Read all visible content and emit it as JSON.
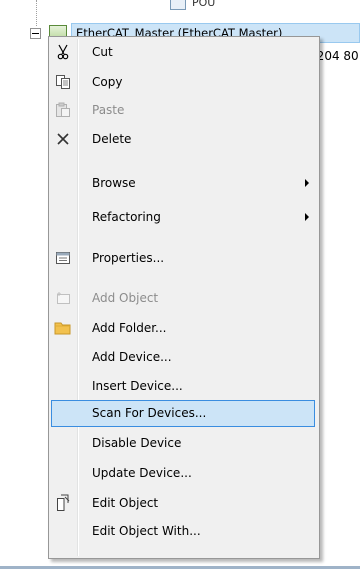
{
  "tree": {
    "top_item_label": "POU",
    "master_label": "EtherCAT_Master (EtherCAT Master)",
    "side_text": "[204 80"
  },
  "menu": {
    "items": [
      {
        "label": "Cut",
        "icon": "scissors-icon",
        "enabled": true
      },
      {
        "label": "Copy",
        "icon": "copy-icon",
        "enabled": true
      },
      {
        "label": "Paste",
        "icon": "paste-icon",
        "enabled": false
      },
      {
        "label": "Delete",
        "icon": "delete-icon",
        "enabled": true
      },
      {
        "label": "Browse",
        "has_submenu": true,
        "enabled": true
      },
      {
        "label": "Refactoring",
        "has_submenu": true,
        "enabled": true
      },
      {
        "label": "Properties...",
        "icon": "properties-icon",
        "enabled": true
      },
      {
        "label": "Add Object",
        "icon": "add-object-icon",
        "enabled": false
      },
      {
        "label": "Add Folder...",
        "icon": "folder-icon",
        "enabled": true
      },
      {
        "label": "Add Device...",
        "enabled": true
      },
      {
        "label": "Insert Device...",
        "enabled": true
      },
      {
        "label": "Scan For Devices...",
        "enabled": true,
        "selected": true
      },
      {
        "label": "Disable Device",
        "enabled": true
      },
      {
        "label": "Update Device...",
        "enabled": true
      },
      {
        "label": "Edit Object",
        "icon": "edit-object-icon",
        "enabled": true
      },
      {
        "label": "Edit Object With...",
        "enabled": true
      }
    ]
  },
  "colors": {
    "selection_bg": "#cce4f7",
    "selection_border": "#3a8de0",
    "menu_bg": "#f0f0f0",
    "folder": "#f2c14e"
  }
}
